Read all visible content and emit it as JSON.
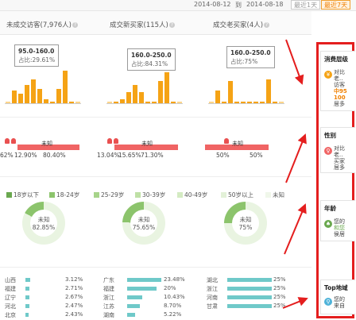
{
  "date_range": {
    "start": "2014-08-12",
    "to": "到",
    "end": "2014-08-18",
    "btn1": "最近1天",
    "btn2": "最近7天"
  },
  "columns": [
    {
      "title": "未成交访客(7,976人)"
    },
    {
      "title": "成交新买家(115人)"
    },
    {
      "title": "成交老买家(4人)"
    }
  ],
  "help": "?",
  "chart_data": [
    {
      "type": "bar",
      "title": "",
      "series": [
        {
          "name": "",
          "values": [
            0.05,
            0.35,
            0.25,
            0.5,
            0.65,
            0.4,
            0.1,
            0.05,
            0.4,
            0.9,
            0.05,
            0.05
          ]
        }
      ],
      "tooltip": {
        "range": "95.0-160.0",
        "share": "占比:29.61%"
      }
    },
    {
      "type": "bar",
      "title": "",
      "series": [
        {
          "name": "",
          "values": [
            0.02,
            0.04,
            0.1,
            0.3,
            0.5,
            0.3,
            0.05,
            0.05,
            0.6,
            0.85,
            0.05,
            0.05
          ]
        }
      ],
      "tooltip": {
        "range": "160.0-250.0",
        "share": "占比:84.31%"
      }
    },
    {
      "type": "bar",
      "title": "",
      "series": [
        {
          "name": "",
          "values": [
            0.05,
            0.35,
            0.05,
            0.6,
            0.05,
            0.05,
            0.05,
            0.05,
            0.05,
            0.65,
            0.05,
            0.05
          ]
        }
      ],
      "tooltip": {
        "range": "160.0-250.0",
        "share": "占比:75%"
      }
    }
  ],
  "gender": [
    {
      "unknown_label": "未知",
      "male": "62%",
      "female": "12.90%",
      "unknown": "80.40%"
    },
    {
      "unknown_label": "未知",
      "male": "13.04%",
      "female": "15.65%",
      "unknown": "71.30%"
    },
    {
      "unknown_label": "未知",
      "male": "50%",
      "female": "",
      "unknown": "50%"
    }
  ],
  "age_legend": [
    "18岁以下",
    "18-24岁",
    "25-29岁",
    "30-39岁",
    "40-49岁",
    "50岁以上",
    "未知"
  ],
  "age_donuts": [
    {
      "center_label": "未知",
      "pct": "82.85%",
      "value": 82.85
    },
    {
      "center_label": "未知",
      "pct": "75.65%",
      "value": 75.65
    },
    {
      "center_label": "未知",
      "pct": "75%",
      "value": 75
    }
  ],
  "regions": [
    [
      {
        "name": "山西",
        "pct": "3.12%",
        "value": 3.12
      },
      {
        "name": "福建",
        "pct": "2.71%",
        "value": 2.71
      },
      {
        "name": "辽宁",
        "pct": "2.67%",
        "value": 2.67
      },
      {
        "name": "河北",
        "pct": "2.47%",
        "value": 2.47
      },
      {
        "name": "北京",
        "pct": "2.43%",
        "value": 2.43
      }
    ],
    [
      {
        "name": "广东",
        "pct": "23.48%",
        "value": 23.48
      },
      {
        "name": "福建",
        "pct": "20%",
        "value": 20
      },
      {
        "name": "浙江",
        "pct": "10.43%",
        "value": 10.43
      },
      {
        "name": "江苏",
        "pct": "8.70%",
        "value": 8.7
      },
      {
        "name": "湖南",
        "pct": "5.22%",
        "value": 5.22
      }
    ],
    [
      {
        "name": "湖北",
        "pct": "25%",
        "value": 25
      },
      {
        "name": "浙江",
        "pct": "25%",
        "value": 25
      },
      {
        "name": "河南",
        "pct": "25%",
        "value": 25
      },
      {
        "name": "甘肃",
        "pct": "25%",
        "value": 25
      },
      {
        "name": "",
        "pct": "",
        "value": 0
      }
    ]
  ],
  "side_cards": [
    {
      "title": "消费层级",
      "icon": "¥",
      "lines": [
        "对比",
        "老..",
        "访客"
      ],
      "hl": [
        "中95",
        "100"
      ],
      "tail": "居多"
    },
    {
      "title": "性别",
      "icon": "♀",
      "lines": [
        "对比",
        "老..",
        "买家",
        "居多"
      ]
    },
    {
      "title": "年龄",
      "icon": "♠",
      "lines": [
        "您的",
        "和您",
        "侯居"
      ]
    },
    {
      "title": "Top地域",
      "icon": "⚲",
      "lines": [
        "您的",
        "来自"
      ]
    }
  ],
  "colors": {
    "accent": "#f5a315",
    "gender": "#f06464",
    "region": "#6fc9c9",
    "highlight": "#e41e1e"
  }
}
